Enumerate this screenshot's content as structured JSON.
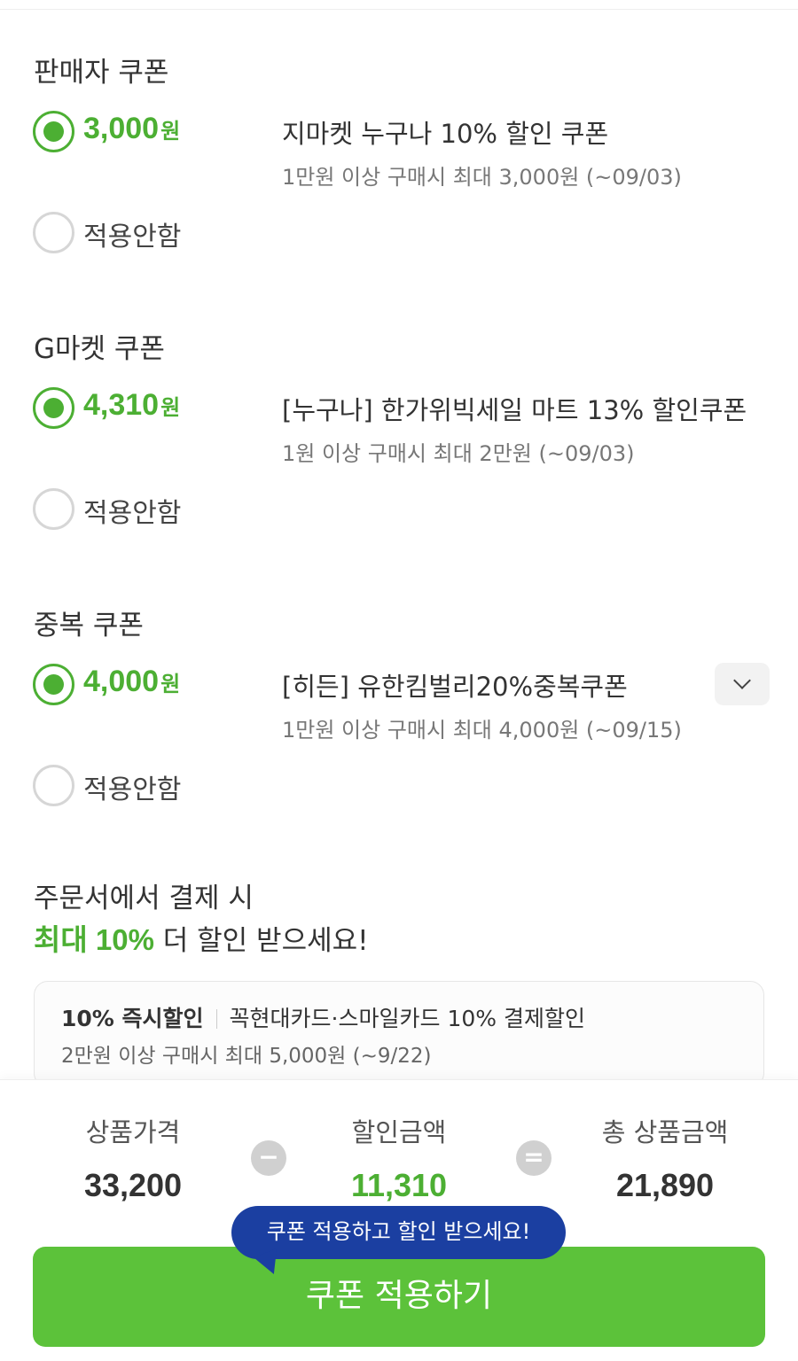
{
  "seller": {
    "title": "판매자 쿠폰",
    "amount": "3,000",
    "won": "원",
    "coupon_name": "지마켓 누구나 10% 할인 쿠폰",
    "condition": "1만원 이상 구매시 최대 3,000원 (~09/03)",
    "none_label": "적용안함"
  },
  "gmarket": {
    "title": "G마켓 쿠폰",
    "amount": "4,310",
    "won": "원",
    "coupon_name": "[누구나] 한가위빅세일 마트 13% 할인쿠폰",
    "condition": "1원 이상 구매시 최대 2만원 (~09/03)",
    "none_label": "적용안함"
  },
  "duplicate": {
    "title": "중복 쿠폰",
    "amount": "4,000",
    "won": "원",
    "coupon_name": "[히든] 유한킴벌리20%중복쿠폰",
    "condition": "1만원 이상 구매시 최대 4,000원 (~09/15)",
    "none_label": "적용안함"
  },
  "promo": {
    "line1": "주문서에서 결제 시",
    "highlight": "최대 10%",
    "line2_rest": " 더 할인 받으세요!"
  },
  "card_benefit": {
    "tag": "10% 즉시할인",
    "description": "꼭현대카드·스마일카드 10% 결제할인",
    "condition": "2만원 이상 구매시 최대 5,000원 (~9/22)"
  },
  "summary": {
    "product_price_label": "상품가격",
    "product_price": "33,200",
    "minus": "−",
    "discount_label": "할인금액",
    "discount": "11,310",
    "equals": "=",
    "total_label": "총 상품금액",
    "total": "21,890"
  },
  "tooltip": "쿠폰 적용하고 할인 받으세요!",
  "apply_button": "쿠폰 적용하기",
  "colors": {
    "accent_green": "#4caf33",
    "button_green": "#5cc23a",
    "tooltip_blue": "#1b3fa1"
  }
}
